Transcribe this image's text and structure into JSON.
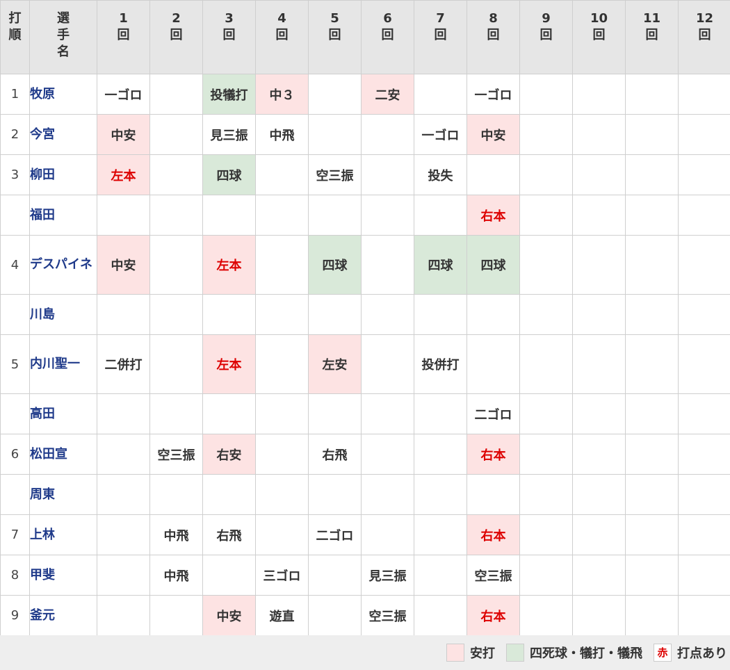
{
  "header": {
    "order_label": "打順",
    "player_label": "選手名",
    "innings": [
      {
        "num": "1",
        "kai": "回"
      },
      {
        "num": "2",
        "kai": "回"
      },
      {
        "num": "3",
        "kai": "回"
      },
      {
        "num": "4",
        "kai": "回"
      },
      {
        "num": "5",
        "kai": "回"
      },
      {
        "num": "6",
        "kai": "回"
      },
      {
        "num": "7",
        "kai": "回"
      },
      {
        "num": "8",
        "kai": "回"
      },
      {
        "num": "9",
        "kai": "回"
      },
      {
        "num": "10",
        "kai": "回"
      },
      {
        "num": "11",
        "kai": "回"
      },
      {
        "num": "12",
        "kai": "回"
      }
    ]
  },
  "rows": [
    {
      "order": "1",
      "player": "牧原",
      "cells": [
        {
          "text": "一ゴロ",
          "type": ""
        },
        {
          "text": "",
          "type": ""
        },
        {
          "text": "投犠打",
          "type": "walk"
        },
        {
          "text": "中３",
          "type": "hit"
        },
        {
          "text": "",
          "type": ""
        },
        {
          "text": "二安",
          "type": "hit"
        },
        {
          "text": "",
          "type": ""
        },
        {
          "text": "一ゴロ",
          "type": ""
        },
        {
          "text": "",
          "type": ""
        },
        {
          "text": "",
          "type": ""
        },
        {
          "text": "",
          "type": ""
        },
        {
          "text": "",
          "type": ""
        }
      ]
    },
    {
      "order": "2",
      "player": "今宮",
      "cells": [
        {
          "text": "中安",
          "type": "hit"
        },
        {
          "text": "",
          "type": ""
        },
        {
          "text": "見三振",
          "type": ""
        },
        {
          "text": "中飛",
          "type": ""
        },
        {
          "text": "",
          "type": ""
        },
        {
          "text": "",
          "type": ""
        },
        {
          "text": "一ゴロ",
          "type": ""
        },
        {
          "text": "中安",
          "type": "hit"
        },
        {
          "text": "",
          "type": ""
        },
        {
          "text": "",
          "type": ""
        },
        {
          "text": "",
          "type": ""
        },
        {
          "text": "",
          "type": ""
        }
      ]
    },
    {
      "order": "3",
      "player": "柳田",
      "cells": [
        {
          "text": "左本",
          "type": "hit",
          "rbi": true
        },
        {
          "text": "",
          "type": ""
        },
        {
          "text": "四球",
          "type": "walk"
        },
        {
          "text": "",
          "type": ""
        },
        {
          "text": "空三振",
          "type": ""
        },
        {
          "text": "",
          "type": ""
        },
        {
          "text": "投失",
          "type": ""
        },
        {
          "text": "",
          "type": ""
        },
        {
          "text": "",
          "type": ""
        },
        {
          "text": "",
          "type": ""
        },
        {
          "text": "",
          "type": ""
        },
        {
          "text": "",
          "type": ""
        }
      ]
    },
    {
      "order": "",
      "player": "福田",
      "cells": [
        {
          "text": "",
          "type": ""
        },
        {
          "text": "",
          "type": ""
        },
        {
          "text": "",
          "type": ""
        },
        {
          "text": "",
          "type": ""
        },
        {
          "text": "",
          "type": ""
        },
        {
          "text": "",
          "type": ""
        },
        {
          "text": "",
          "type": ""
        },
        {
          "text": "右本",
          "type": "hit",
          "rbi": true
        },
        {
          "text": "",
          "type": ""
        },
        {
          "text": "",
          "type": ""
        },
        {
          "text": "",
          "type": ""
        },
        {
          "text": "",
          "type": ""
        }
      ]
    },
    {
      "order": "4",
      "player": "デスパイネ",
      "tall": true,
      "cells": [
        {
          "text": "中安",
          "type": "hit"
        },
        {
          "text": "",
          "type": ""
        },
        {
          "text": "左本",
          "type": "hit",
          "rbi": true
        },
        {
          "text": "",
          "type": ""
        },
        {
          "text": "四球",
          "type": "walk"
        },
        {
          "text": "",
          "type": ""
        },
        {
          "text": "四球",
          "type": "walk"
        },
        {
          "text": "四球",
          "type": "walk"
        },
        {
          "text": "",
          "type": ""
        },
        {
          "text": "",
          "type": ""
        },
        {
          "text": "",
          "type": ""
        },
        {
          "text": "",
          "type": ""
        }
      ]
    },
    {
      "order": "",
      "player": "川島",
      "cells": [
        {
          "text": "",
          "type": ""
        },
        {
          "text": "",
          "type": ""
        },
        {
          "text": "",
          "type": ""
        },
        {
          "text": "",
          "type": ""
        },
        {
          "text": "",
          "type": ""
        },
        {
          "text": "",
          "type": ""
        },
        {
          "text": "",
          "type": ""
        },
        {
          "text": "",
          "type": ""
        },
        {
          "text": "",
          "type": ""
        },
        {
          "text": "",
          "type": ""
        },
        {
          "text": "",
          "type": ""
        },
        {
          "text": "",
          "type": ""
        }
      ]
    },
    {
      "order": "5",
      "player": "内川聖一",
      "tall": true,
      "cells": [
        {
          "text": "二併打",
          "type": ""
        },
        {
          "text": "",
          "type": ""
        },
        {
          "text": "左本",
          "type": "hit",
          "rbi": true
        },
        {
          "text": "",
          "type": ""
        },
        {
          "text": "左安",
          "type": "hit"
        },
        {
          "text": "",
          "type": ""
        },
        {
          "text": "投併打",
          "type": ""
        },
        {
          "text": "",
          "type": ""
        },
        {
          "text": "",
          "type": ""
        },
        {
          "text": "",
          "type": ""
        },
        {
          "text": "",
          "type": ""
        },
        {
          "text": "",
          "type": ""
        }
      ]
    },
    {
      "order": "",
      "player": "高田",
      "cells": [
        {
          "text": "",
          "type": ""
        },
        {
          "text": "",
          "type": ""
        },
        {
          "text": "",
          "type": ""
        },
        {
          "text": "",
          "type": ""
        },
        {
          "text": "",
          "type": ""
        },
        {
          "text": "",
          "type": ""
        },
        {
          "text": "",
          "type": ""
        },
        {
          "text": "二ゴロ",
          "type": ""
        },
        {
          "text": "",
          "type": ""
        },
        {
          "text": "",
          "type": ""
        },
        {
          "text": "",
          "type": ""
        },
        {
          "text": "",
          "type": ""
        }
      ]
    },
    {
      "order": "6",
      "player": "松田宣",
      "cells": [
        {
          "text": "",
          "type": ""
        },
        {
          "text": "空三振",
          "type": ""
        },
        {
          "text": "右安",
          "type": "hit"
        },
        {
          "text": "",
          "type": ""
        },
        {
          "text": "右飛",
          "type": ""
        },
        {
          "text": "",
          "type": ""
        },
        {
          "text": "",
          "type": ""
        },
        {
          "text": "右本",
          "type": "hit",
          "rbi": true
        },
        {
          "text": "",
          "type": ""
        },
        {
          "text": "",
          "type": ""
        },
        {
          "text": "",
          "type": ""
        },
        {
          "text": "",
          "type": ""
        }
      ]
    },
    {
      "order": "",
      "player": "周東",
      "cells": [
        {
          "text": "",
          "type": ""
        },
        {
          "text": "",
          "type": ""
        },
        {
          "text": "",
          "type": ""
        },
        {
          "text": "",
          "type": ""
        },
        {
          "text": "",
          "type": ""
        },
        {
          "text": "",
          "type": ""
        },
        {
          "text": "",
          "type": ""
        },
        {
          "text": "",
          "type": ""
        },
        {
          "text": "",
          "type": ""
        },
        {
          "text": "",
          "type": ""
        },
        {
          "text": "",
          "type": ""
        },
        {
          "text": "",
          "type": ""
        }
      ]
    },
    {
      "order": "7",
      "player": "上林",
      "cells": [
        {
          "text": "",
          "type": ""
        },
        {
          "text": "中飛",
          "type": ""
        },
        {
          "text": "右飛",
          "type": ""
        },
        {
          "text": "",
          "type": ""
        },
        {
          "text": "二ゴロ",
          "type": ""
        },
        {
          "text": "",
          "type": ""
        },
        {
          "text": "",
          "type": ""
        },
        {
          "text": "右本",
          "type": "hit",
          "rbi": true
        },
        {
          "text": "",
          "type": ""
        },
        {
          "text": "",
          "type": ""
        },
        {
          "text": "",
          "type": ""
        },
        {
          "text": "",
          "type": ""
        }
      ]
    },
    {
      "order": "8",
      "player": "甲斐",
      "cells": [
        {
          "text": "",
          "type": ""
        },
        {
          "text": "中飛",
          "type": ""
        },
        {
          "text": "",
          "type": ""
        },
        {
          "text": "三ゴロ",
          "type": ""
        },
        {
          "text": "",
          "type": ""
        },
        {
          "text": "見三振",
          "type": ""
        },
        {
          "text": "",
          "type": ""
        },
        {
          "text": "空三振",
          "type": ""
        },
        {
          "text": "",
          "type": ""
        },
        {
          "text": "",
          "type": ""
        },
        {
          "text": "",
          "type": ""
        },
        {
          "text": "",
          "type": ""
        }
      ]
    },
    {
      "order": "9",
      "player": "釜元",
      "cells": [
        {
          "text": "",
          "type": ""
        },
        {
          "text": "",
          "type": ""
        },
        {
          "text": "中安",
          "type": "hit"
        },
        {
          "text": "遊直",
          "type": ""
        },
        {
          "text": "",
          "type": ""
        },
        {
          "text": "空三振",
          "type": ""
        },
        {
          "text": "",
          "type": ""
        },
        {
          "text": "右本",
          "type": "hit",
          "rbi": true
        },
        {
          "text": "",
          "type": ""
        },
        {
          "text": "",
          "type": ""
        },
        {
          "text": "",
          "type": ""
        },
        {
          "text": "",
          "type": ""
        }
      ]
    }
  ],
  "legend": {
    "hit_label": "安打",
    "walk_label": "四死球・犠打・犠飛",
    "rbi_swatch": "赤",
    "rbi_label": "打点あり"
  },
  "colors": {
    "hit_bg": "#fde3e3",
    "walk_bg": "#d9e9d9",
    "rbi_text": "#dd0000",
    "player_text": "#1f3a8a",
    "header_bg": "#e6e6e6"
  }
}
